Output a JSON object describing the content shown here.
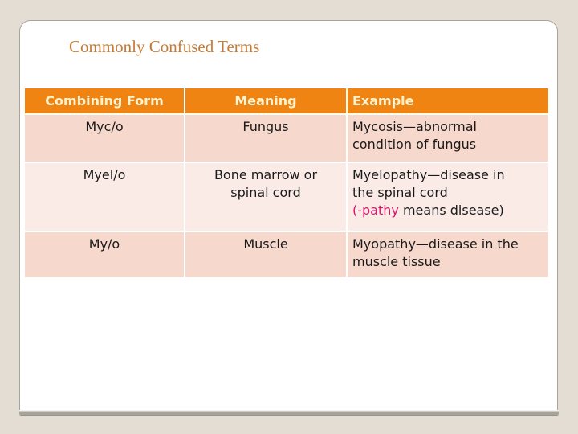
{
  "slide": {
    "title": "Commonly Confused Terms"
  },
  "table": {
    "headers": [
      "Combining Form",
      "Meaning",
      "Example"
    ],
    "rows": [
      {
        "form": "Myc/o",
        "meaning": "Fungus",
        "example_lines": [
          "Mycosis—abnormal",
          "condition of fungus"
        ]
      },
      {
        "form": "Myel/o",
        "meaning_lines": [
          "Bone marrow or",
          "spinal cord"
        ],
        "example_lines": [
          "Myelopathy—disease in",
          "the spinal cord"
        ],
        "example_note": {
          "open": "(",
          "highlight": "-pathy",
          "rest": " means disease)"
        }
      },
      {
        "form": "My/o",
        "meaning": "Muscle",
        "example_lines": [
          "Myopathy—disease in the",
          "muscle tissue"
        ]
      }
    ]
  },
  "colors": {
    "header_bg": "#EF8413",
    "header_text": "#FFF2CC",
    "row_odd": "#F6D8CC",
    "row_even": "#FAEBE7",
    "highlight": "#D6176E",
    "title": "#C67B35"
  }
}
